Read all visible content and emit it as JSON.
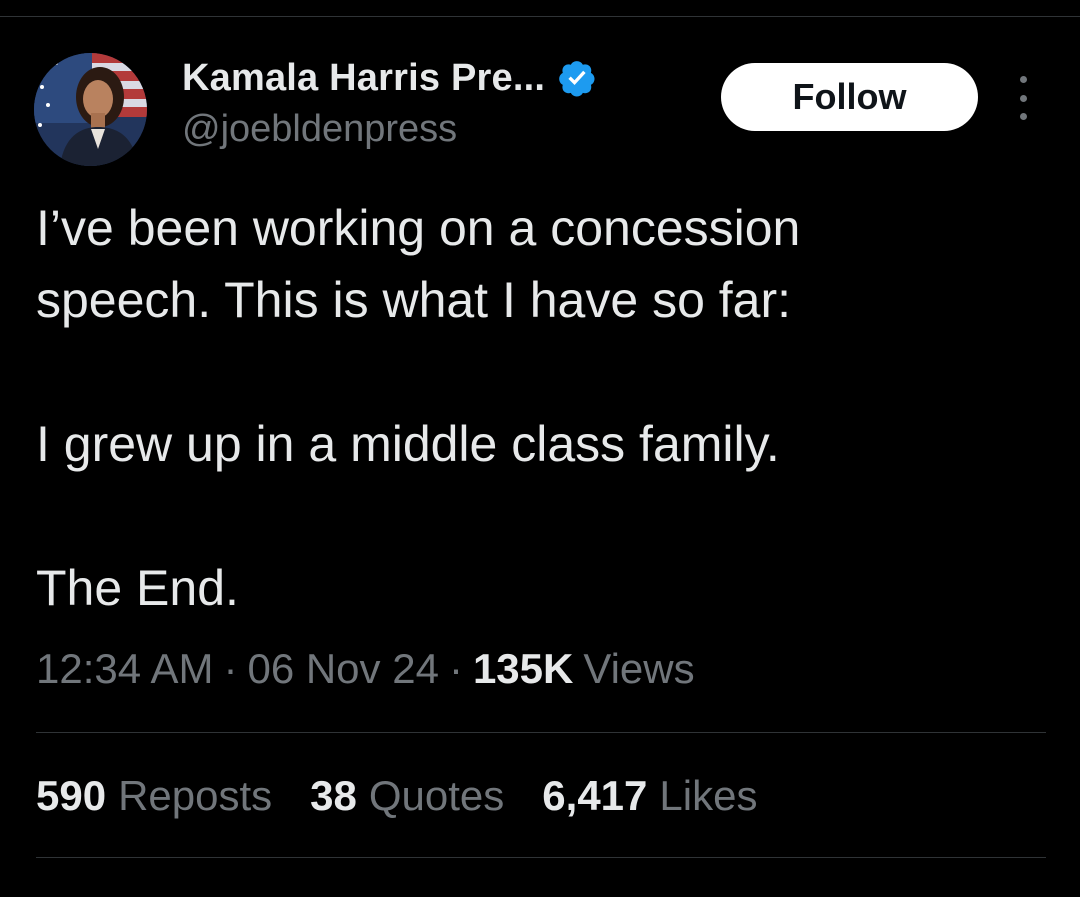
{
  "author": {
    "display_name": "Kamala Harris Pre...",
    "handle": "@joebldenpress",
    "verified": true,
    "avatar_icon": "profile-photo"
  },
  "actions": {
    "follow_label": "Follow",
    "more_icon": "more-vertical-icon"
  },
  "tweet": {
    "lines": [
      "I’ve been working on a concession",
      "speech. This is what I have so far:",
      "I grew up in a middle class family.",
      "The End."
    ]
  },
  "meta": {
    "time": "12:34 AM",
    "separator": "·",
    "date": "06 Nov 24",
    "views_count": "135K",
    "views_label": "Views"
  },
  "stats": [
    {
      "count": "590",
      "label": "Reposts"
    },
    {
      "count": "38",
      "label": "Quotes"
    },
    {
      "count": "6,417",
      "label": "Likes"
    }
  ],
  "colors": {
    "background": "#000000",
    "primary_text": "#e7e9ea",
    "secondary_text": "#71767b",
    "divider": "#2f3336",
    "verified_blue": "#1d9bf0",
    "button_bg": "#ffffff"
  }
}
